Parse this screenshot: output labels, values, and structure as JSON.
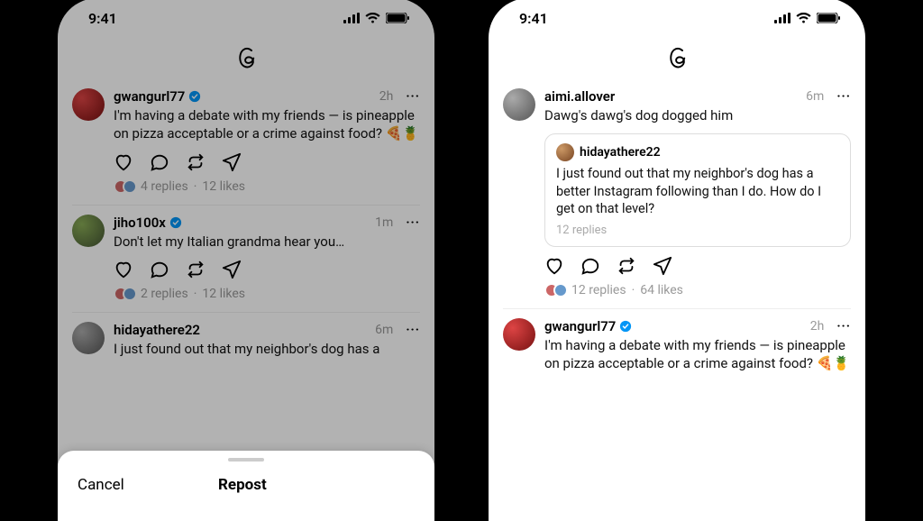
{
  "status": {
    "time": "9:41"
  },
  "left": {
    "posts": [
      {
        "user": "gwangurl77",
        "verified": true,
        "time": "2h",
        "text": "I'm having a debate with my friends — is pineapple on pizza acceptable or a crime against food? 🍕🍍",
        "replies": "4 replies",
        "likes": "12 likes"
      },
      {
        "user": "jiho100x",
        "verified": true,
        "time": "1m",
        "text": "Don't let my Italian grandma hear you…",
        "replies": "2 replies",
        "likes": "12 likes"
      },
      {
        "user": "hidayathere22",
        "verified": false,
        "time": "6m",
        "text": "I just found out that my neighbor's dog has a"
      }
    ],
    "sheet": {
      "cancel": "Cancel",
      "title": "Repost"
    }
  },
  "right": {
    "posts": [
      {
        "user": "aimi.allover",
        "verified": false,
        "time": "6m",
        "text": "Dawg's dawg's dog dogged him",
        "quote": {
          "user": "hidayathere22",
          "text": "I just found out that my neighbor's dog has a better Instagram following than I do. How do I get on that level?",
          "replies": "12 replies"
        },
        "replies": "12 replies",
        "likes": "64 likes"
      },
      {
        "user": "gwangurl77",
        "verified": true,
        "time": "2h",
        "text": "I'm having a debate with my friends — is pineapple on pizza acceptable or a crime against food? 🍕🍍"
      }
    ]
  }
}
